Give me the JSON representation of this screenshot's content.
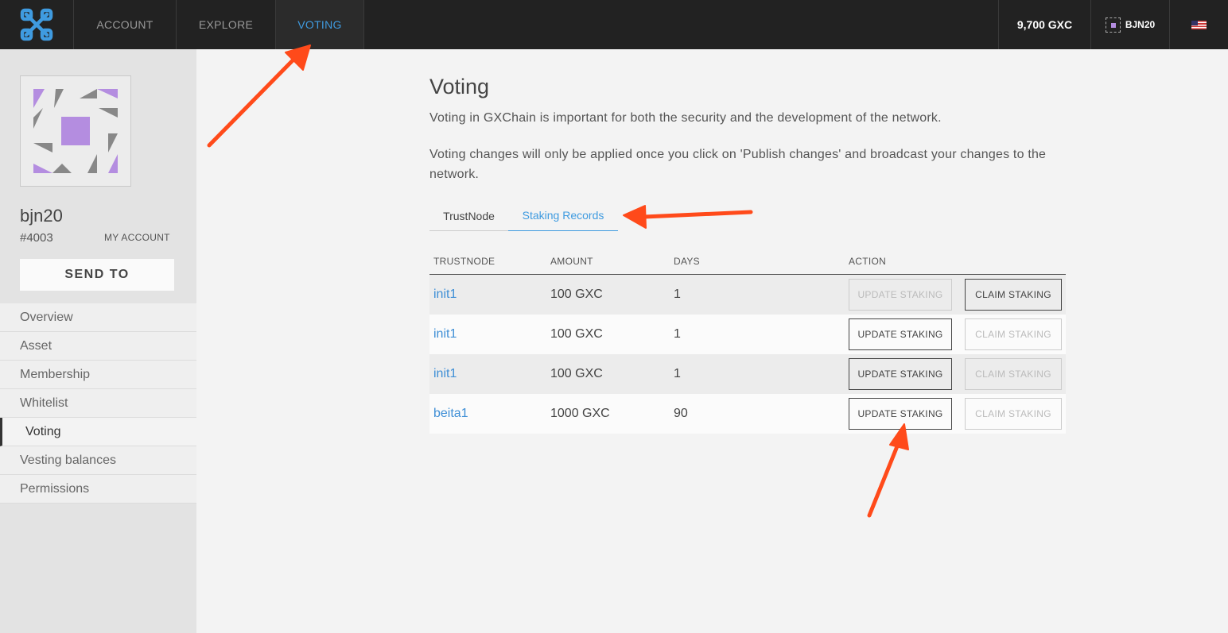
{
  "nav": {
    "tabs": [
      {
        "label": "ACCOUNT"
      },
      {
        "label": "EXPLORE"
      },
      {
        "label": "VOTING"
      }
    ],
    "balance": "9,700 GXC",
    "user": "BJN20",
    "logo_icon": "gxchain-logo-icon",
    "language_icon": "us-flag-icon"
  },
  "sidebar": {
    "account_name": "bjn20",
    "account_id": "#4003",
    "my_account_label": "MY ACCOUNT",
    "send_to_label": "SEND TO",
    "menu": [
      {
        "label": "Overview"
      },
      {
        "label": "Asset"
      },
      {
        "label": "Membership"
      },
      {
        "label": "Whitelist"
      },
      {
        "label": "Voting"
      },
      {
        "label": "Vesting balances"
      },
      {
        "label": "Permissions"
      }
    ],
    "active_menu": "Voting"
  },
  "main": {
    "title": "Voting",
    "description1": "Voting in GXChain is important for both the security and the development of the network.",
    "description2": "Voting changes will only be applied once you click on 'Publish changes' and broadcast your changes to the network.",
    "subtabs": [
      {
        "label": "TrustNode"
      },
      {
        "label": "Staking Records"
      }
    ],
    "active_subtab": "Staking Records",
    "table": {
      "headers": [
        "TRUSTNODE",
        "AMOUNT",
        "DAYS",
        "ACTION"
      ],
      "update_label": "UPDATE STAKING",
      "claim_label": "CLAIM STAKING",
      "rows": [
        {
          "trustnode": "init1",
          "amount": "100 GXC",
          "days": "1",
          "update_enabled": false,
          "claim_enabled": true
        },
        {
          "trustnode": "init1",
          "amount": "100 GXC",
          "days": "1",
          "update_enabled": true,
          "claim_enabled": false
        },
        {
          "trustnode": "init1",
          "amount": "100 GXC",
          "days": "1",
          "update_enabled": true,
          "claim_enabled": false
        },
        {
          "trustnode": "beita1",
          "amount": "1000 GXC",
          "days": "90",
          "update_enabled": true,
          "claim_enabled": false
        }
      ]
    }
  },
  "colors": {
    "accent": "#3f9be0",
    "link": "#3f8fd6",
    "annotation_arrow": "#ff4a1a",
    "topbar": "#222222",
    "avatar_purple": "#b48de0"
  }
}
